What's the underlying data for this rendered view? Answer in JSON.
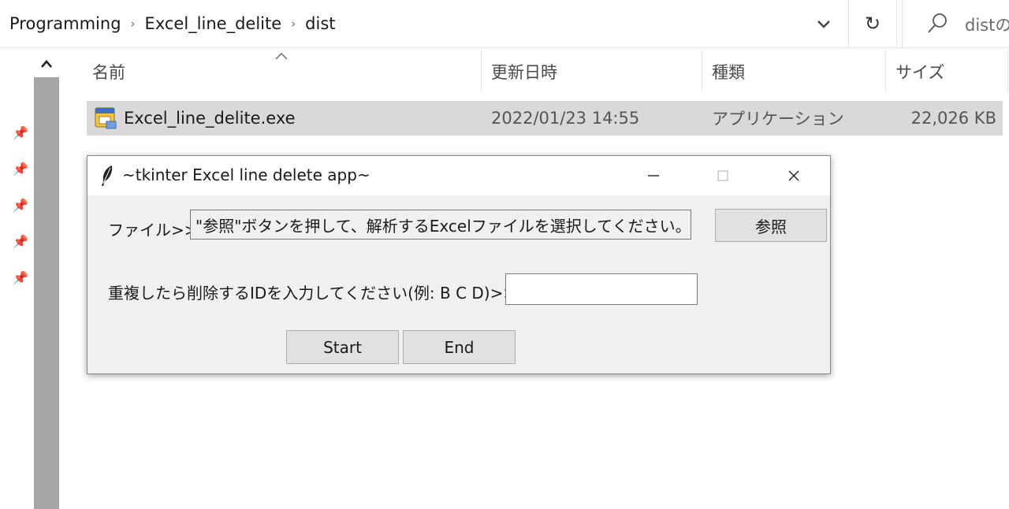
{
  "breadcrumb": {
    "items": [
      "Programming",
      "Excel_line_delite",
      "dist"
    ],
    "separator": "›"
  },
  "search": {
    "placeholder": "distの"
  },
  "columns": {
    "name": "名前",
    "modified": "更新日時",
    "type": "種類",
    "size": "サイズ"
  },
  "files": [
    {
      "name": "Excel_line_delite.exe",
      "modified": "2022/01/23 14:55",
      "type": "アプリケーション",
      "size": "22,026 KB"
    }
  ],
  "tk_window": {
    "title": "~tkinter Excel line delete app~",
    "file_label": "ファイル>>",
    "file_entry_text": "\"参照\"ボタンを押して、解析するExcelファイルを選択してください。",
    "browse_button": "参照",
    "id_label": "重複したら削除するIDを入力してください(例: B C D)>>",
    "id_entry_value": "",
    "start_button": "Start",
    "end_button": "End"
  },
  "colors": {
    "selection": "#d9d9d9",
    "scrollbar": "#a6a6a6",
    "dialog_bg": "#f0f0f0",
    "button_bg": "#e1e1e1"
  }
}
